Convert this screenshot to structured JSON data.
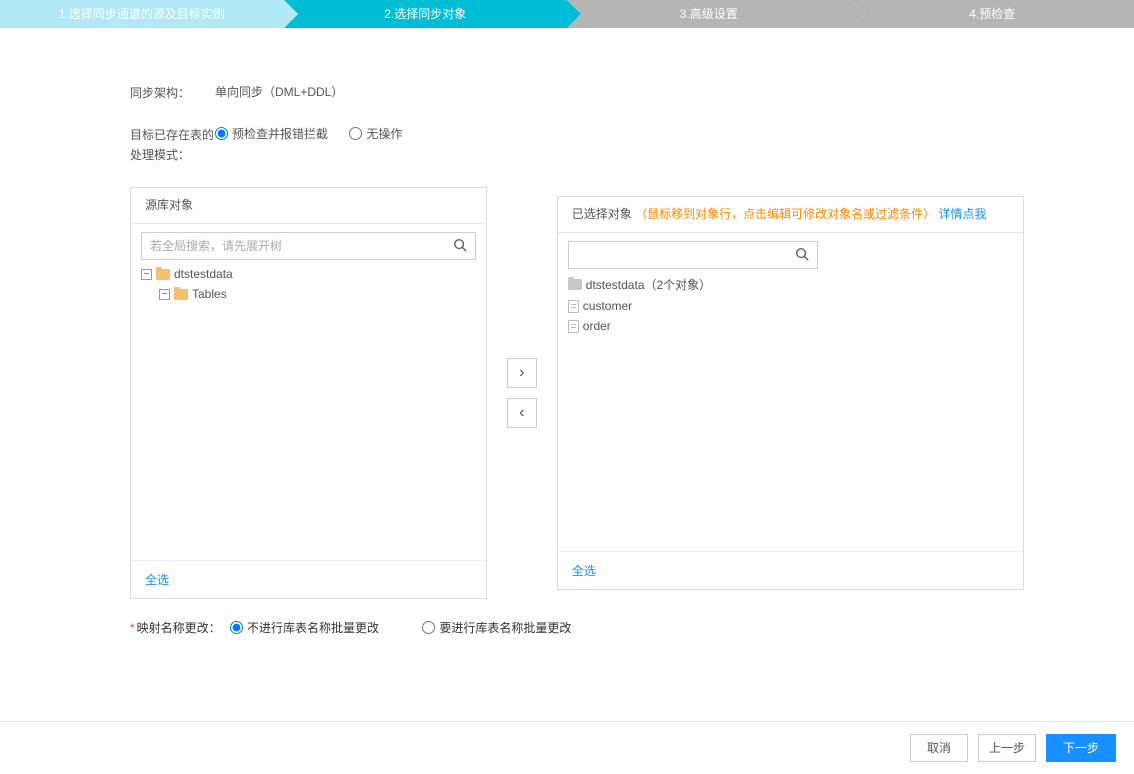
{
  "steps": {
    "s1": "1.选择同步通道的源及目标实例",
    "s2": "2.选择同步对象",
    "s3": "3.高级设置",
    "s4": "4.预检查"
  },
  "sync_mode": {
    "label": "同步架构：",
    "value": "单向同步（DML+DDL）"
  },
  "handle_mode": {
    "label": "目标已存在表的处理模式：",
    "opt1": "预检查并报错拦截",
    "opt2": "无操作"
  },
  "source_panel": {
    "title": "源库对象",
    "search_placeholder": "若全局搜索，请先展开树",
    "tree_db": "dtstestdata",
    "tree_tables": "Tables",
    "select_all": "全选"
  },
  "target_panel": {
    "title": "已选择对象",
    "hint": "（鼠标移到对象行，点击编辑可修改对象名或过滤条件）",
    "detail_link": "详情点我",
    "db": "dtstestdata（2个对象）",
    "t1": "customer",
    "t2": "order",
    "select_all": "全选"
  },
  "mapping": {
    "label": "映射名称更改：",
    "opt1": "不进行库表名称批量更改",
    "opt2": "要进行库表名称批量更改"
  },
  "footer": {
    "cancel": "取消",
    "prev": "上一步",
    "next": "下一步"
  }
}
